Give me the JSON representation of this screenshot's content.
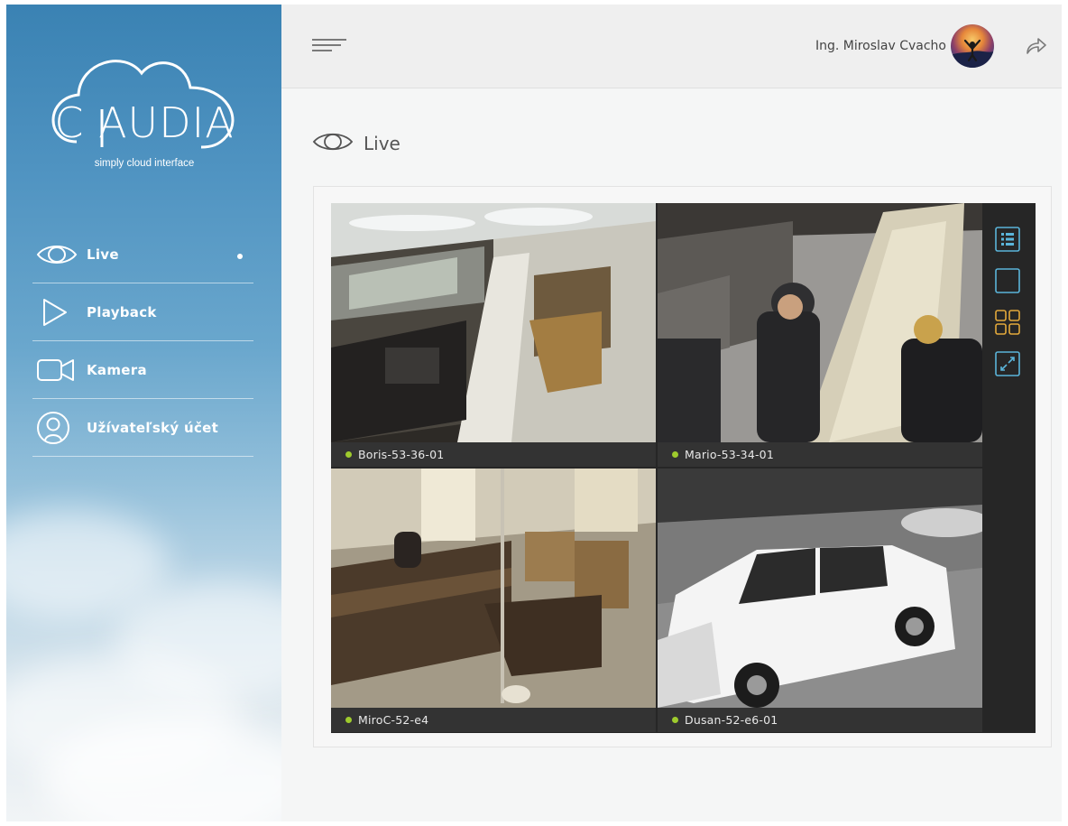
{
  "brand": {
    "logo_text": "C AUDIA",
    "tagline": "simply cloud interface"
  },
  "sidebar": {
    "items": [
      {
        "label": "Live",
        "icon": "eye-icon",
        "active": true
      },
      {
        "label": "Playback",
        "icon": "play-icon",
        "active": false
      },
      {
        "label": "Kamera",
        "icon": "camera-icon",
        "active": false
      },
      {
        "label": "Užívateľský účet",
        "icon": "user-icon",
        "active": false
      }
    ]
  },
  "header": {
    "user_name": "Ing. Miroslav Cvacho",
    "menu_icon": "hamburger-icon",
    "logout_icon": "logout-arrow-icon"
  },
  "page": {
    "title": "Live",
    "title_icon": "eye-icon"
  },
  "cameras": [
    {
      "label": "Boris-53-36-01",
      "status": "online"
    },
    {
      "label": "Mario-53-34-01",
      "status": "online"
    },
    {
      "label": "MiroC-52-e4",
      "status": "online"
    },
    {
      "label": "Dusan-52-e6-01",
      "status": "online"
    }
  ],
  "controls": [
    {
      "name": "list-view-icon"
    },
    {
      "name": "single-view-icon"
    },
    {
      "name": "grid-view-icon",
      "active": true
    },
    {
      "name": "fullscreen-icon"
    }
  ],
  "colors": {
    "accent_blue": "#5ab4d9",
    "accent_gold": "#e2a83b",
    "status_online": "#9ecb2d",
    "sidebar_top": "#3a82b3"
  }
}
